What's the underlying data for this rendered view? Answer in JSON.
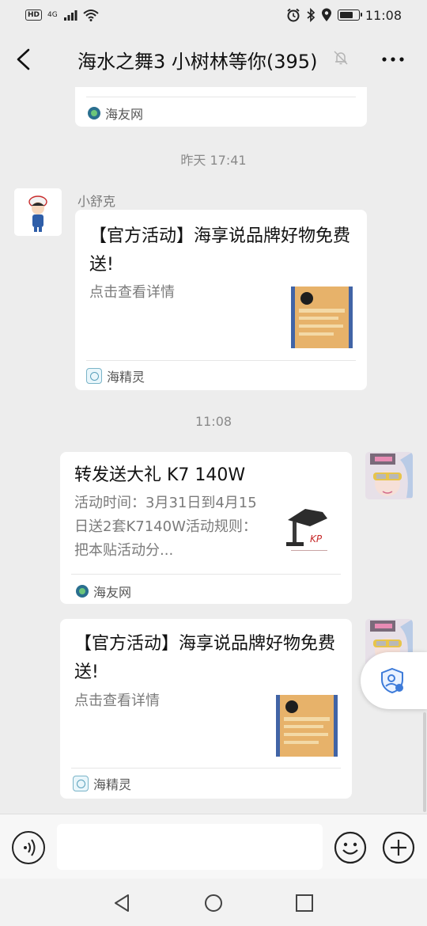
{
  "status_bar": {
    "hd": "HD",
    "network": "4G",
    "time": "11:08",
    "battery_level": 0.75
  },
  "header": {
    "title": "海水之舞3 小树林等你(395)"
  },
  "messages": {
    "partial_card": {
      "source": "海友网"
    },
    "timestamp_1": "昨天 17:41",
    "msg1": {
      "sender": "小舒克",
      "title": "【官方活动】海享说品牌好物免费送!",
      "desc": "点击查看详情",
      "source": "海精灵"
    },
    "timestamp_2": "11:08",
    "msg2": {
      "title": "转发送大礼 K7 140W",
      "desc": "活动时间：3月31日到4月15日送2套K7140W活动规则：把本贴活动分...",
      "source": "海友网",
      "thumb_label": "KP"
    },
    "msg3": {
      "title": "【官方活动】海享说品牌好物免费送!",
      "desc": "点击查看详情",
      "source": "海精灵"
    }
  },
  "input_bar": {
    "placeholder": ""
  },
  "icons": {
    "back": "chevron-left-icon",
    "mute": "bell-off-icon",
    "more": "ellipsis-icon",
    "voice": "voice-icon",
    "emoji": "smile-icon",
    "plus": "plus-icon",
    "float": "shield-user-icon"
  },
  "colors": {
    "chat_bg": "#ededed",
    "bubble": "#ffffff",
    "muted_text": "#7b7b7b"
  }
}
